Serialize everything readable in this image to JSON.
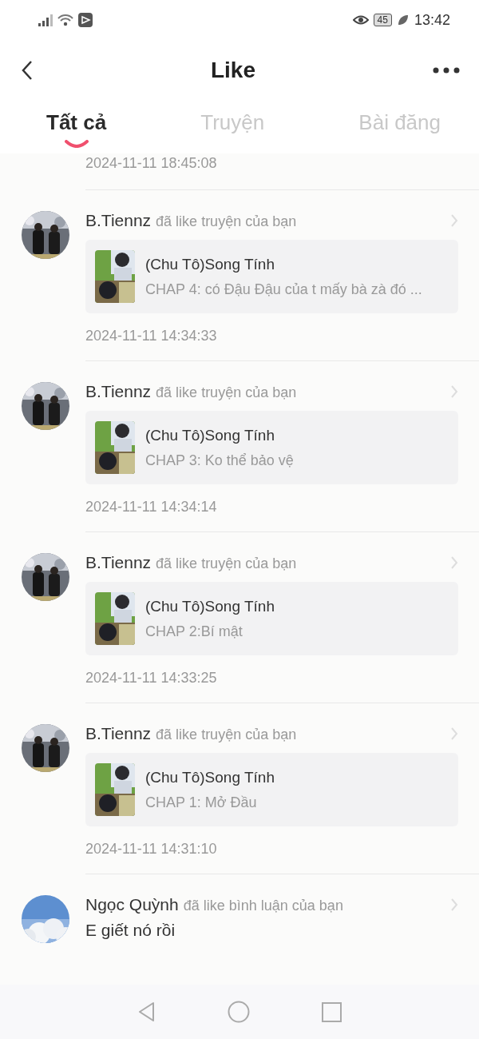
{
  "status_bar": {
    "time": "13:42",
    "battery": "45"
  },
  "header": {
    "title": "Like"
  },
  "tabs": [
    {
      "label": "Tất cả",
      "selected": true
    },
    {
      "label": "Truyện",
      "selected": false
    },
    {
      "label": "Bài đăng",
      "selected": false
    }
  ],
  "items": [
    {
      "kind": "time_only",
      "time": "2024-11-11 18:45:08"
    },
    {
      "kind": "story",
      "user": "B.Tiennz",
      "action": "đã like truyện của bạn",
      "story_title": "(Chu Tô)Song Tính",
      "chapter": "CHAP 4: có Đậu Đậu của t mấy bà zà đó ...",
      "time": "2024-11-11 14:34:33"
    },
    {
      "kind": "story",
      "user": "B.Tiennz",
      "action": "đã like truyện của bạn",
      "story_title": "(Chu Tô)Song Tính",
      "chapter": "CHAP 3: Ko thể bảo vệ",
      "time": "2024-11-11 14:34:14"
    },
    {
      "kind": "story",
      "user": "B.Tiennz",
      "action": "đã like truyện của bạn",
      "story_title": "(Chu Tô)Song Tính",
      "chapter": "CHAP 2:Bí mật",
      "time": "2024-11-11 14:33:25"
    },
    {
      "kind": "story",
      "user": "B.Tiennz",
      "action": "đã like truyện của bạn",
      "story_title": "(Chu Tô)Song Tính",
      "chapter": "CHAP 1: Mở Đầu",
      "time": "2024-11-11 14:31:10"
    },
    {
      "kind": "comment",
      "user": "Ngọc Quỳnh",
      "action": "đã like bình luận của bạn",
      "comment": "E giết nó rồi"
    }
  ]
}
